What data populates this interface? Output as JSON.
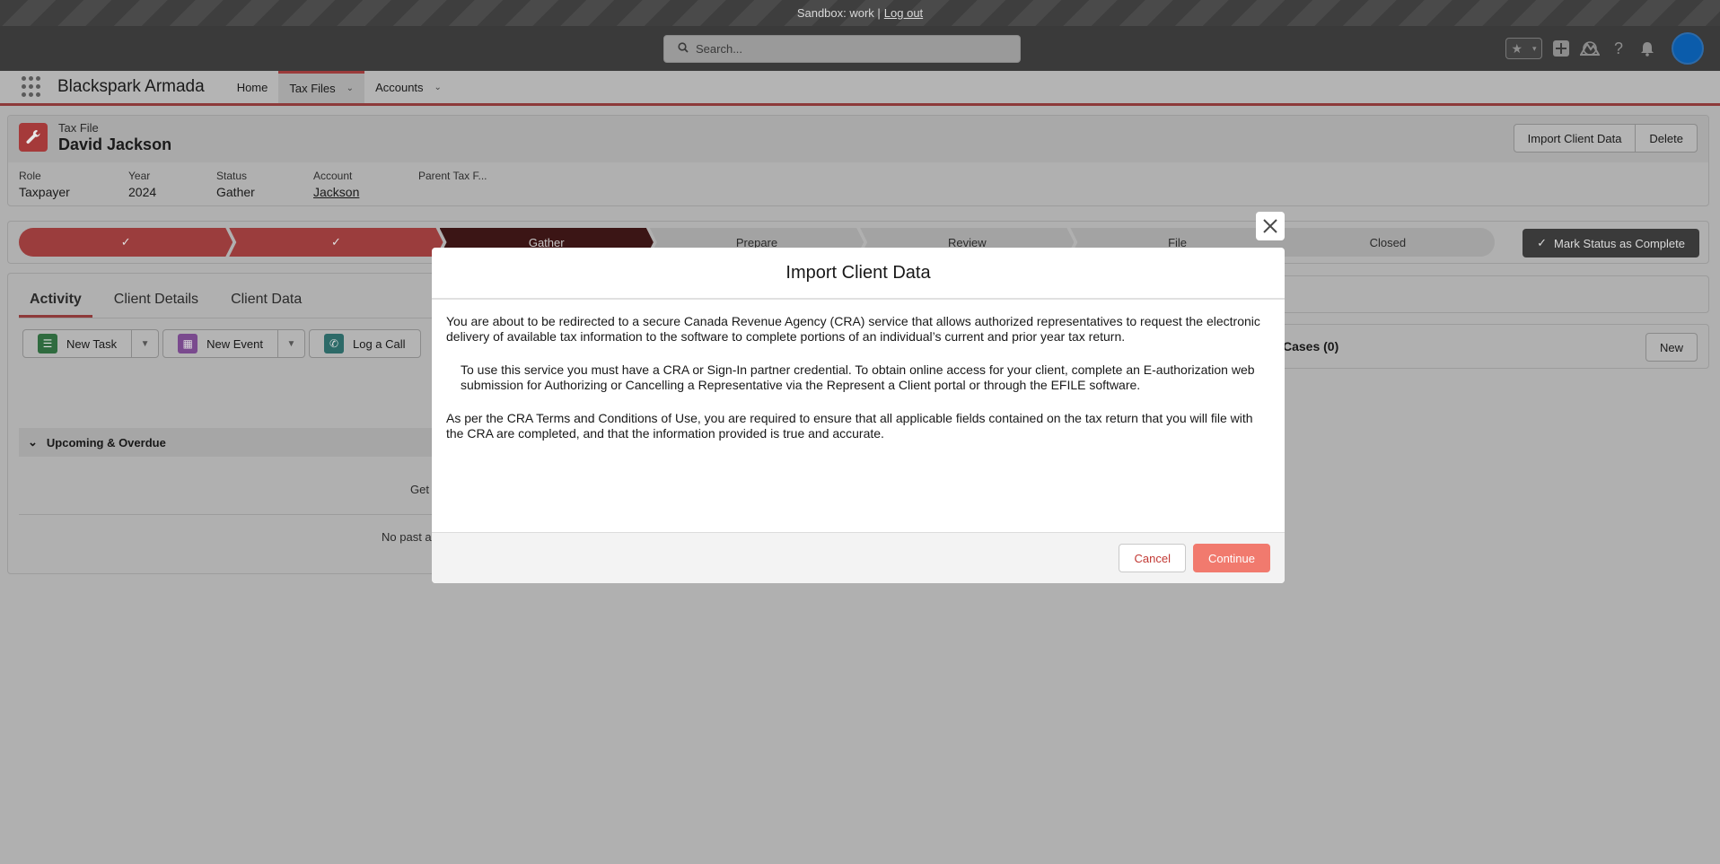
{
  "sandbox": {
    "label": "Sandbox: work |",
    "logout": "Log out"
  },
  "header": {
    "search_placeholder": "Search..."
  },
  "appnav": {
    "app_name": "Blackspark Armada",
    "items": [
      {
        "label": "Home"
      },
      {
        "label": "Tax Files"
      },
      {
        "label": "Accounts"
      }
    ]
  },
  "record": {
    "type": "Tax File",
    "name": "David Jackson",
    "buttons": {
      "import": "Import Client Data",
      "delete": "Delete"
    },
    "fields": [
      {
        "label": "Role",
        "value": "Taxpayer"
      },
      {
        "label": "Year",
        "value": "2024"
      },
      {
        "label": "Status",
        "value": "Gather"
      },
      {
        "label": "Account",
        "value": "Jackson"
      },
      {
        "label": "Parent Tax F...",
        "value": ""
      }
    ]
  },
  "path": {
    "stages": [
      {
        "label": "✓"
      },
      {
        "label": "✓"
      },
      {
        "label": "Gather"
      },
      {
        "label": "Prepare"
      },
      {
        "label": "Review"
      },
      {
        "label": "File"
      },
      {
        "label": "Closed"
      }
    ],
    "mark_complete": "Mark Status as Complete"
  },
  "activity": {
    "tabs": [
      {
        "label": "Activity"
      },
      {
        "label": "Client Details"
      },
      {
        "label": "Client Data"
      }
    ],
    "actions": {
      "new_task": "New Task",
      "new_event": "New Event",
      "log_call": "Log a Call"
    },
    "upcoming": "Upcoming & Overdue",
    "get_text": "Get",
    "no_past": "No past a"
  },
  "related": {
    "card1_title": ")",
    "card2_title": "Cases (0)",
    "new_button": "New"
  },
  "modal": {
    "title": "Import Client Data",
    "p1": "You are about to be redirected to a secure Canada Revenue Agency (CRA) service that allows authorized representatives to request the electronic delivery of available tax information to the software to complete portions of an individual’s current and prior year tax return.",
    "p2": "To use this service you must have a CRA or Sign-In partner credential. To obtain online access for your client, complete an E-authorization web submission for Authorizing or Cancelling a Representative via the Represent a Client portal or through the EFILE software.",
    "p3": "As per the CRA Terms and Conditions of Use, you are required to ensure that all applicable fields contained on the tax return that you will file with the CRA are completed, and that the information provided is true and accurate.",
    "cancel": "Cancel",
    "continue": "Continue"
  }
}
